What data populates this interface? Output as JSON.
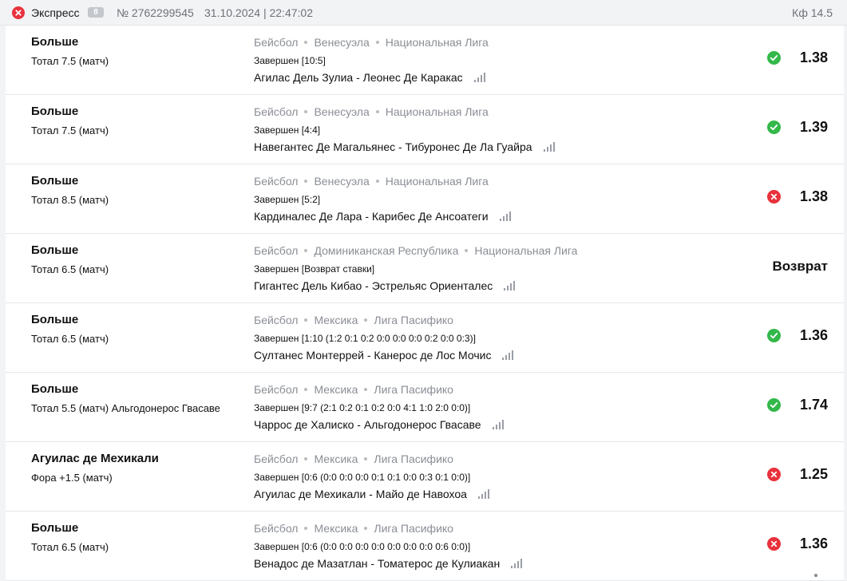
{
  "header": {
    "status_icon": "close-circle-icon",
    "status_color": "#e8323c",
    "bet_type": "Экспресс",
    "events_count": "8",
    "bet_number": "№ 2762299545",
    "datetime": "31.10.2024 | 22:47:02",
    "kf_label": "Кф",
    "kf_value": "14.5"
  },
  "colors": {
    "win": "#33b84a",
    "lose": "#e8323c",
    "accent_text": "#111111",
    "muted_text": "#8a8e95"
  },
  "bets": [
    {
      "outcome": "Больше",
      "market": "Тотал 7.5 (матч)",
      "sport": "Бейсбол",
      "country": "Венесуэла",
      "league": "Национальная Лига",
      "result": "Завершен [10:5]",
      "match": "Агилас Дель Зулиа - Леонес Де Каракас",
      "status": "win",
      "status_icon": "check-circle-icon",
      "odds": "1.38"
    },
    {
      "outcome": "Больше",
      "market": "Тотал 7.5 (матч)",
      "sport": "Бейсбол",
      "country": "Венесуэла",
      "league": "Национальная Лига",
      "result": "Завершен [4:4]",
      "match": "Навегантес Де Магальянес - Тибуронес Де Ла Гуайра",
      "status": "win",
      "status_icon": "check-circle-icon",
      "odds": "1.39"
    },
    {
      "outcome": "Больше",
      "market": "Тотал 8.5 (матч)",
      "sport": "Бейсбол",
      "country": "Венесуэла",
      "league": "Национальная Лига",
      "result": "Завершен [5:2]",
      "match": "Кардиналес Де Лара - Карибес Де Ансоатеги",
      "status": "lose",
      "status_icon": "cross-circle-icon",
      "odds": "1.38"
    },
    {
      "outcome": "Больше",
      "market": "Тотал 6.5 (матч)",
      "sport": "Бейсбол",
      "country": "Доминиканская Республика",
      "league": "Национальная Лига",
      "result": "Завершен [Возврат ставки]",
      "match": "Гигантес Дель Кибао - Эстрельяс Ориенталес",
      "status": "refund",
      "status_icon": "",
      "odds": "Возврат"
    },
    {
      "outcome": "Больше",
      "market": "Тотал 6.5 (матч)",
      "sport": "Бейсбол",
      "country": "Мексика",
      "league": "Лига Пасифико",
      "result": "Завершен [1:10 (1:2 0:1 0:2 0:0 0:0 0:0 0:2 0:0 0:3)]",
      "match": "Султанес Монтеррей - Канерос де Лос Мочис",
      "status": "win",
      "status_icon": "check-circle-icon",
      "odds": "1.36"
    },
    {
      "outcome": "Больше",
      "market": "Тотал 5.5 (матч) Альгодонерос Гвасаве",
      "sport": "Бейсбол",
      "country": "Мексика",
      "league": "Лига Пасифико",
      "result": "Завершен [9:7 (2:1 0:2 0:1 0:2 0:0 4:1 1:0 2:0 0:0)]",
      "match": "Чаррос де Халиско - Альгодонерос Гвасаве",
      "status": "win",
      "status_icon": "check-circle-icon",
      "odds": "1.74"
    },
    {
      "outcome": "Агуилас де Мехикали",
      "market": "Фора +1.5 (матч)",
      "sport": "Бейсбол",
      "country": "Мексика",
      "league": "Лига Пасифико",
      "result": "Завершен [0:6 (0:0 0:0 0:0 0:1 0:1 0:0 0:3 0:1 0:0)]",
      "match": "Агуилас де Мехикали - Майо де Навохоа",
      "status": "lose",
      "status_icon": "cross-circle-icon",
      "odds": "1.25"
    },
    {
      "outcome": "Больше",
      "market": "Тотал 6.5 (матч)",
      "sport": "Бейсбол",
      "country": "Мексика",
      "league": "Лига Пасифико",
      "result": "Завершен [0:6 (0:0 0:0 0:0 0:0 0:0 0:0 0:0 0:6 0:0)]",
      "match": "Венадос де Мазатлан - Томатерос де Кулиакан",
      "status": "lose",
      "status_icon": "cross-circle-icon",
      "odds": "1.36"
    }
  ]
}
